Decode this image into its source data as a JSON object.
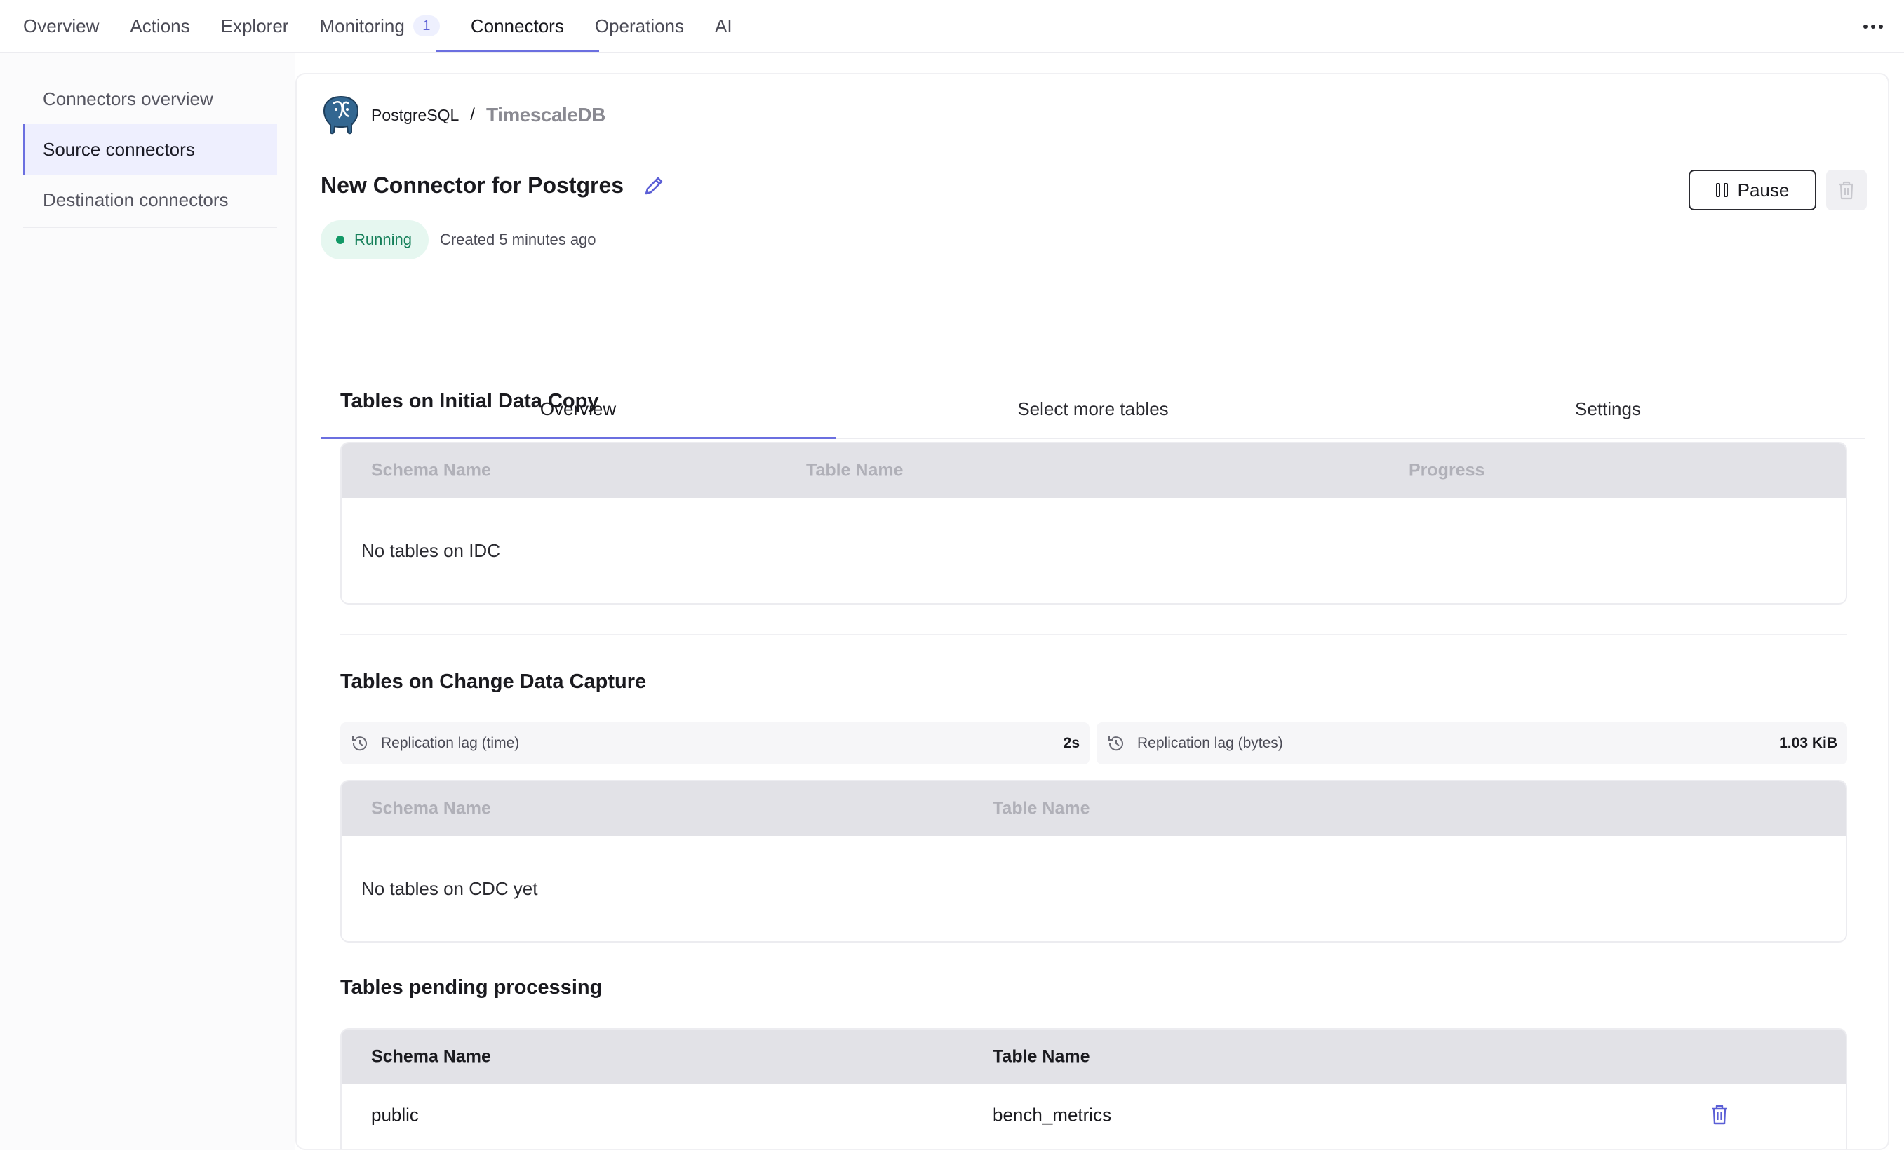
{
  "nav": {
    "items": [
      {
        "label": "Overview"
      },
      {
        "label": "Actions"
      },
      {
        "label": "Explorer"
      },
      {
        "label": "Monitoring",
        "badge": "1"
      },
      {
        "label": "Connectors"
      },
      {
        "label": "Operations"
      },
      {
        "label": "AI"
      }
    ],
    "active": "Connectors"
  },
  "sidebar": {
    "items": [
      {
        "label": "Connectors overview"
      },
      {
        "label": "Source connectors"
      },
      {
        "label": "Destination connectors"
      }
    ],
    "active": "Source connectors"
  },
  "breadcrumb": {
    "source": "PostgreSQL",
    "separator": "/",
    "destination": "TimescaleDB"
  },
  "connector": {
    "title": "New Connector for Postgres",
    "status": "Running",
    "created": "Created 5 minutes ago",
    "pause_label": "Pause"
  },
  "tabs": [
    {
      "label": "Overview"
    },
    {
      "label": "Select more tables"
    },
    {
      "label": "Settings"
    }
  ],
  "idc": {
    "title": "Tables on Initial Data Copy",
    "columns": [
      "Schema Name",
      "Table Name",
      "Progress"
    ],
    "empty": "No tables on IDC"
  },
  "cdc": {
    "title": "Tables on Change Data Capture",
    "lag_time_label": "Replication lag (time)",
    "lag_time_value": "2s",
    "lag_bytes_label": "Replication lag (bytes)",
    "lag_bytes_value": "1.03 KiB",
    "columns": [
      "Schema Name",
      "Table Name"
    ],
    "empty": "No tables on CDC yet"
  },
  "pending": {
    "title": "Tables pending processing",
    "columns": [
      "Schema Name",
      "Table Name"
    ],
    "rows": [
      {
        "schema": "public",
        "table": "bench_metrics"
      }
    ]
  },
  "colors": {
    "accent": "#6b6fe0",
    "running_bg": "#e6f7f0",
    "running_fg": "#16805a"
  }
}
